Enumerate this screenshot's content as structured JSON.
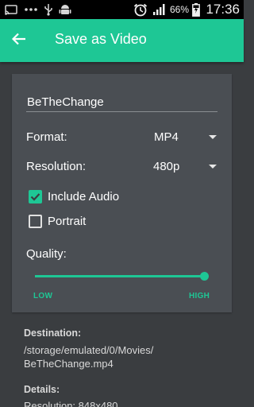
{
  "status_bar": {
    "battery_percent": "66%",
    "time": "17:36",
    "icons": [
      "cast-icon",
      "more-dots-icon",
      "usb-icon",
      "android-icon",
      "alarm-clock-icon",
      "signal-icon",
      "battery-charging-icon"
    ]
  },
  "app_bar": {
    "title": "Save as Video",
    "back_icon": "arrow-left-icon"
  },
  "form": {
    "name": "BeTheChange",
    "format_label": "Format:",
    "format_value": "MP4",
    "resolution_label": "Resolution:",
    "resolution_value": "480p",
    "include_audio_label": "Include Audio",
    "include_audio_checked": true,
    "portrait_label": "Portrait",
    "portrait_checked": false,
    "quality_label": "Quality:",
    "quality_level": 1.0,
    "quality_low": "LOW",
    "quality_high": "HIGH"
  },
  "details": {
    "destination_title": "Destination:",
    "destination_line1": "/storage/emulated/0/Movies/",
    "destination_line2": "BeTheChange.mp4",
    "details_title": "Details:",
    "details_line1": "Resolution: 848x480"
  },
  "colors": {
    "accent": "#1ec795",
    "background": "#3a3d40",
    "card": "#4a4e53"
  }
}
